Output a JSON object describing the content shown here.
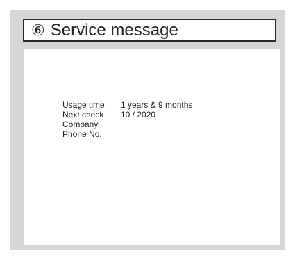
{
  "title": {
    "number": "⑥",
    "text": "Service message"
  },
  "info": {
    "rows": [
      {
        "label": "Usage time",
        "value": "1 years & 9 months"
      },
      {
        "label": "Next check",
        "value": "10 / 2020"
      },
      {
        "label": "Company",
        "value": ""
      },
      {
        "label": "Phone No.",
        "value": ""
      }
    ]
  }
}
